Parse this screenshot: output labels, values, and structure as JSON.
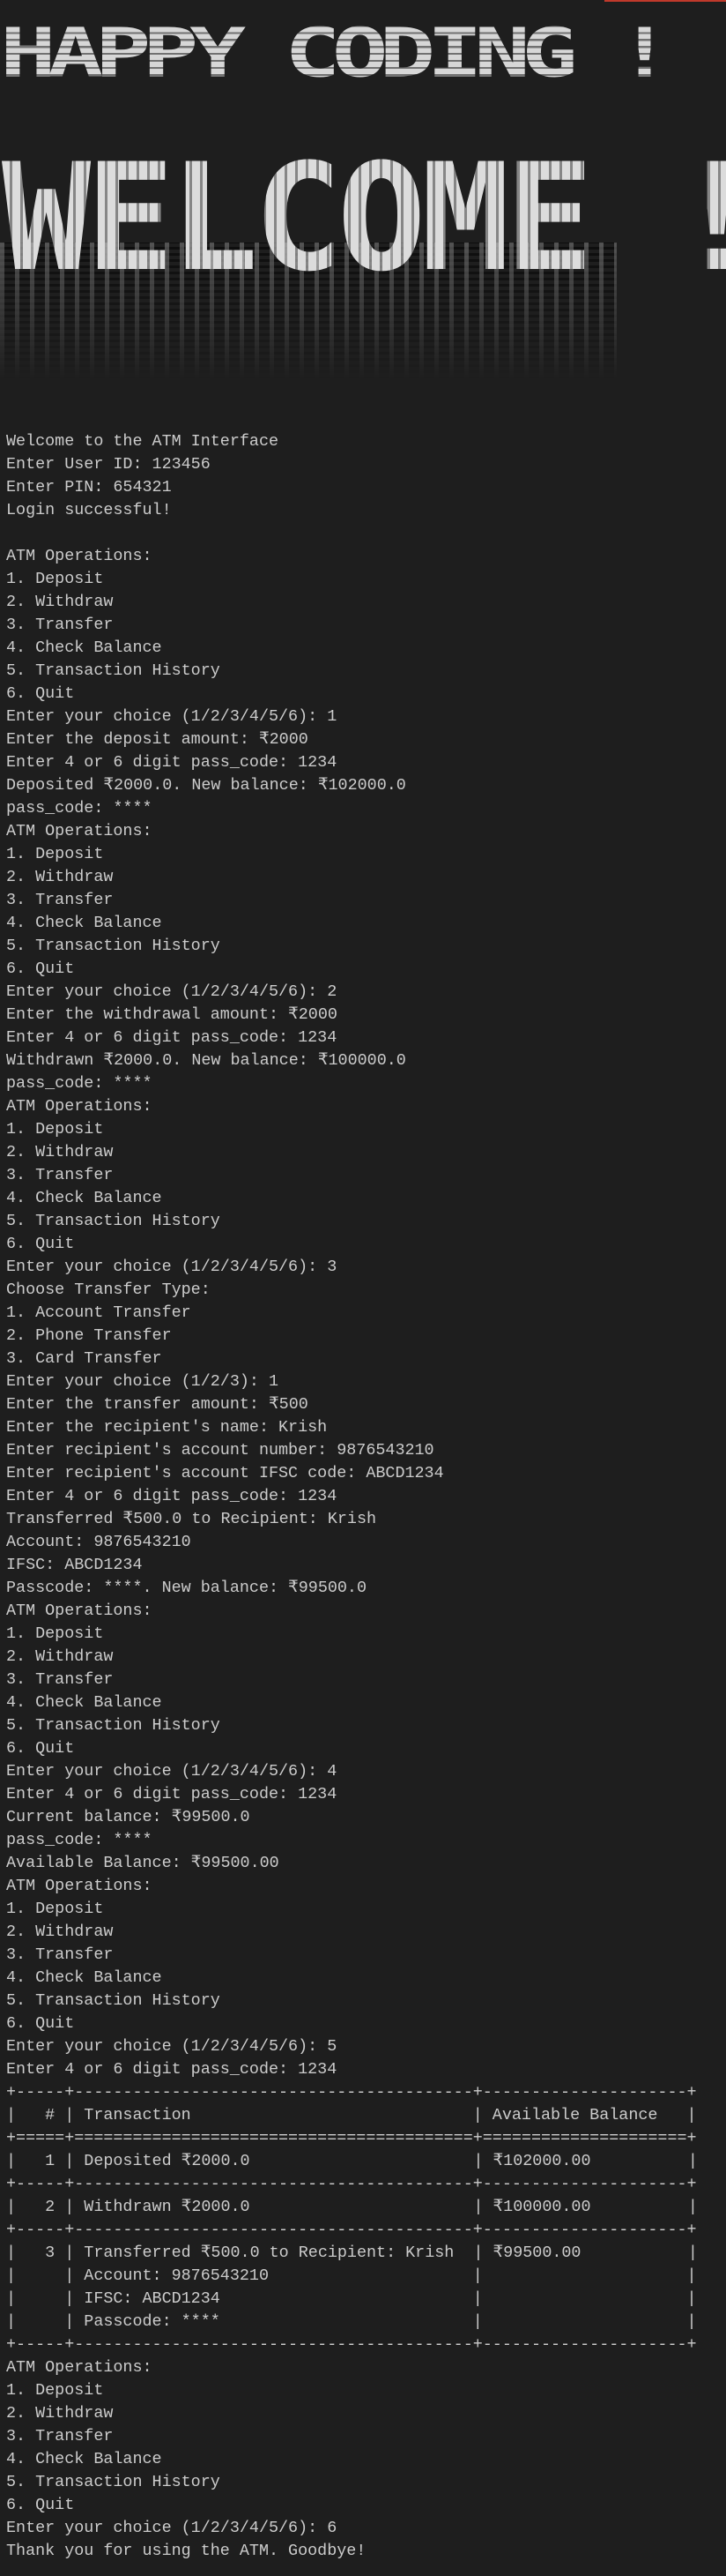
{
  "banner": {
    "line1": "HAPPY CODING !",
    "line2": "WELCOME !"
  },
  "terminal_lines": [
    "Welcome to the ATM Interface",
    "Enter User ID: 123456",
    "Enter PIN: 654321",
    "Login successful!",
    "",
    "ATM Operations:",
    "1. Deposit",
    "2. Withdraw",
    "3. Transfer",
    "4. Check Balance",
    "5. Transaction History",
    "6. Quit",
    "Enter your choice (1/2/3/4/5/6): 1",
    "Enter the deposit amount: ₹2000",
    "Enter 4 or 6 digit pass_code: 1234",
    "Deposited ₹2000.0. New balance: ₹102000.0",
    "pass_code: ****",
    "ATM Operations:",
    "1. Deposit",
    "2. Withdraw",
    "3. Transfer",
    "4. Check Balance",
    "5. Transaction History",
    "6. Quit",
    "Enter your choice (1/2/3/4/5/6): 2",
    "Enter the withdrawal amount: ₹2000",
    "Enter 4 or 6 digit pass_code: 1234",
    "Withdrawn ₹2000.0. New balance: ₹100000.0",
    "pass_code: ****",
    "ATM Operations:",
    "1. Deposit",
    "2. Withdraw",
    "3. Transfer",
    "4. Check Balance",
    "5. Transaction History",
    "6. Quit",
    "Enter your choice (1/2/3/4/5/6): 3",
    "Choose Transfer Type:",
    "1. Account Transfer",
    "2. Phone Transfer",
    "3. Card Transfer",
    "Enter your choice (1/2/3): 1",
    "Enter the transfer amount: ₹500",
    "Enter the recipient's name: Krish",
    "Enter recipient's account number: 9876543210",
    "Enter recipient's account IFSC code: ABCD1234",
    "Enter 4 or 6 digit pass_code: 1234",
    "Transferred ₹500.0 to Recipient: Krish",
    "Account: 9876543210",
    "IFSC: ABCD1234",
    "Passcode: ****. New balance: ₹99500.0",
    "ATM Operations:",
    "1. Deposit",
    "2. Withdraw",
    "3. Transfer",
    "4. Check Balance",
    "5. Transaction History",
    "6. Quit",
    "Enter your choice (1/2/3/4/5/6): 4",
    "Enter 4 or 6 digit pass_code: 1234",
    "Current balance: ₹99500.0",
    "pass_code: ****",
    "Available Balance: ₹99500.00",
    "ATM Operations:",
    "1. Deposit",
    "2. Withdraw",
    "3. Transfer",
    "4. Check Balance",
    "5. Transaction History",
    "6. Quit",
    "Enter your choice (1/2/3/4/5/6): 5",
    "Enter 4 or 6 digit pass_code: 1234",
    "+-----+-----------------------------------------+---------------------+",
    "|   # | Transaction                             | Available Balance   |",
    "+=====+=========================================+=====================+",
    "|   1 | Deposited ₹2000.0                       | ₹102000.00          |",
    "+-----+-----------------------------------------+---------------------+",
    "|   2 | Withdrawn ₹2000.0                       | ₹100000.00          |",
    "+-----+-----------------------------------------+---------------------+",
    "|   3 | Transferred ₹500.0 to Recipient: Krish  | ₹99500.00           |",
    "|     | Account: 9876543210                     |                     |",
    "|     | IFSC: ABCD1234                          |                     |",
    "|     | Passcode: ****                          |                     |",
    "+-----+-----------------------------------------+---------------------+",
    "ATM Operations:",
    "1. Deposit",
    "2. Withdraw",
    "3. Transfer",
    "4. Check Balance",
    "5. Transaction History",
    "6. Quit",
    "Enter your choice (1/2/3/4/5/6): 6",
    "Thank you for using the ATM. Goodbye!"
  ]
}
